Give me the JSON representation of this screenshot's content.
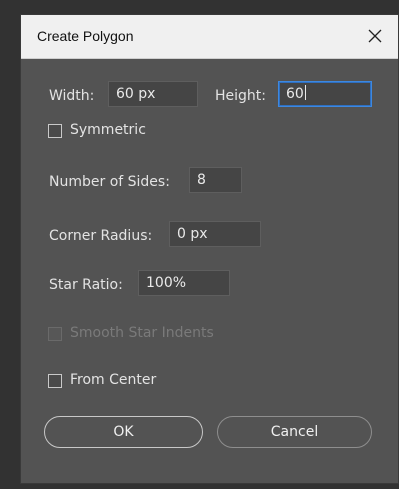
{
  "dialog": {
    "title": "Create Polygon",
    "close_icon": "close-icon"
  },
  "size": {
    "width_label": "Width:",
    "width_value": "60 px",
    "height_label": "Height:",
    "height_value": "60"
  },
  "symmetric": {
    "label": "Symmetric",
    "checked": false
  },
  "sides": {
    "label": "Number of Sides:",
    "value": "8"
  },
  "corner_radius": {
    "label": "Corner Radius:",
    "value": "0 px"
  },
  "star_ratio": {
    "label": "Star Ratio:",
    "value": "100%"
  },
  "smooth_star_indents": {
    "label": "Smooth Star Indents",
    "checked": false,
    "enabled": false
  },
  "from_center": {
    "label": "From Center",
    "checked": false
  },
  "buttons": {
    "ok": "OK",
    "cancel": "Cancel"
  },
  "colors": {
    "dialog_bg": "#535353",
    "titlebar_bg": "#f0f0f0",
    "focus_border": "#3d88e0"
  }
}
